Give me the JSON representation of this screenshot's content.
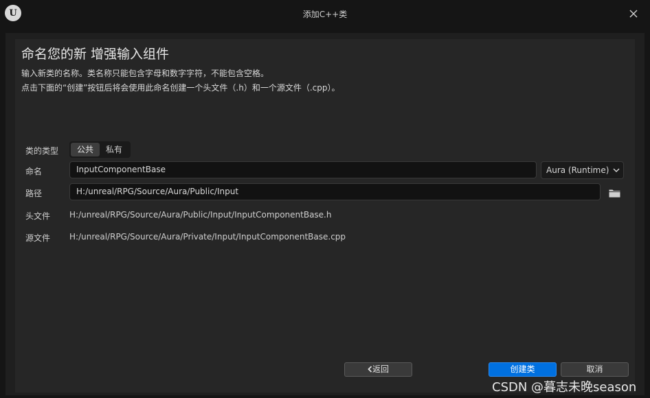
{
  "window": {
    "title": "添加C++类",
    "logo_text": "U"
  },
  "header": {
    "heading": "命名您的新 增强输入组件",
    "description_line1": "输入新类的名称。类名称只能包含字母和数字字符，不能包含空格。",
    "description_line2": "点击下面的“创建”按钮后将会使用此命名创建一个头文件（.h）和一个源文件（.cpp）。"
  },
  "form": {
    "class_type_label": "类的类型",
    "class_type_options": [
      "公共",
      "私有"
    ],
    "class_type_selected": "公共",
    "name_label": "命名",
    "name_value": "InputComponentBase",
    "module_value": "Aura (Runtime)",
    "path_label": "路径",
    "path_value": "H:/unreal/RPG/Source/Aura/Public/Input",
    "header_file_label": "头文件",
    "header_file_value": "H:/unreal/RPG/Source/Aura/Public/Input/InputComponentBase.h",
    "source_file_label": "源文件",
    "source_file_value": "H:/unreal/RPG/Source/Aura/Private/Input/InputComponentBase.cpp"
  },
  "footer": {
    "back_label": "返回",
    "create_label": "创建类",
    "cancel_label": "取消"
  },
  "watermark": "CSDN @暮志未晚season",
  "colors": {
    "accent": "#0070e0",
    "panel": "#262626",
    "background": "#151515"
  },
  "icons": {
    "logo": "unreal-logo-icon",
    "close": "close-icon",
    "dropdown": "chevron-down-icon",
    "folder": "folder-icon",
    "back": "chevron-left-icon"
  }
}
